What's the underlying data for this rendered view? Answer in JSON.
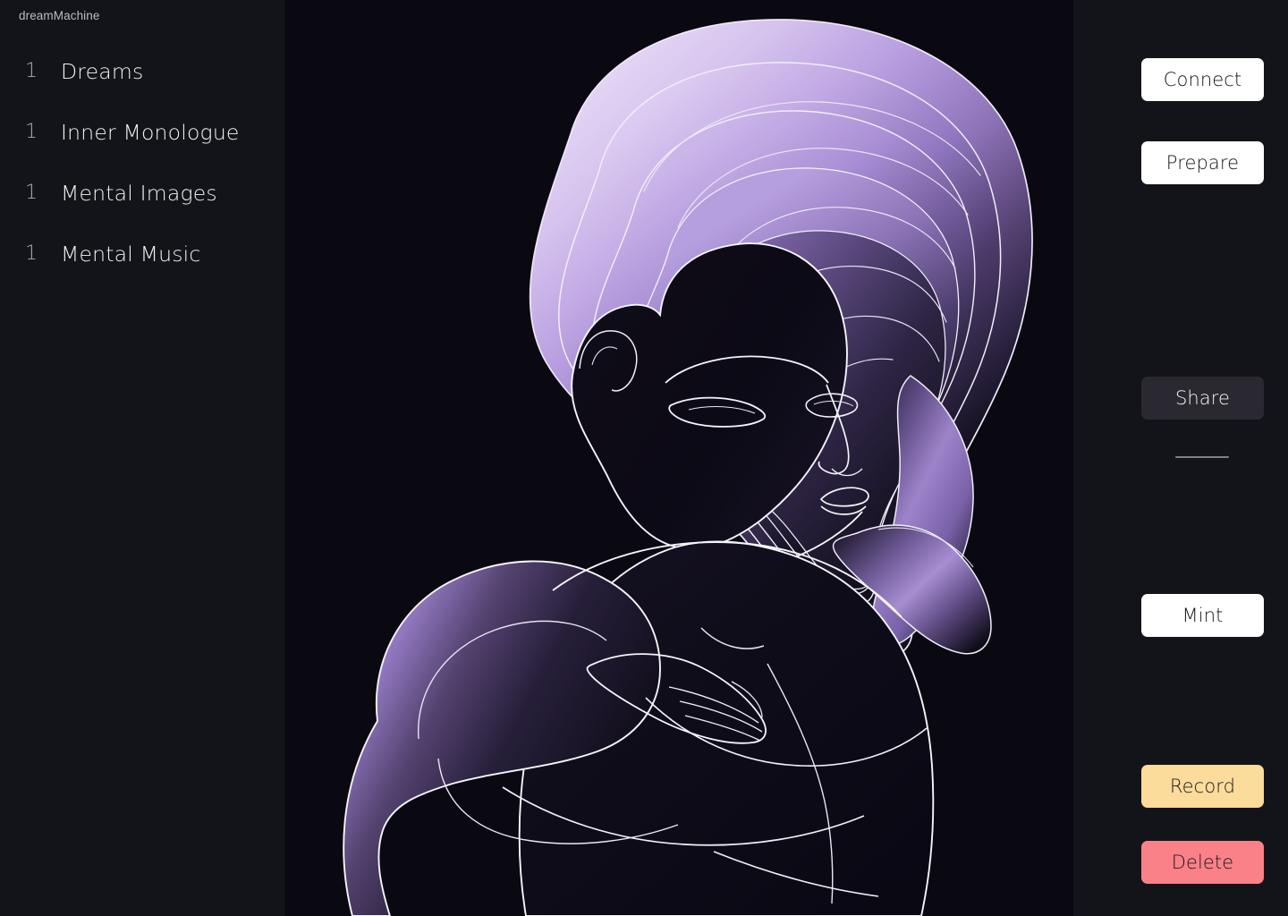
{
  "app": {
    "title": "dreamMachine",
    "background_color": "#131419",
    "canvas_color": "#0a0912"
  },
  "sidebar": {
    "items": [
      {
        "index": "1",
        "label": "Dreams"
      },
      {
        "index": "1",
        "label": "Inner Monologue"
      },
      {
        "index": "1",
        "label": "Mental Images"
      },
      {
        "index": "1",
        "label": "Mental Music"
      }
    ]
  },
  "artwork": {
    "alt": "line-art illustration of a woman with long flowing purple hair, head tilted down, hand on chest",
    "line_color": "#ffffff",
    "hair_light": "#e0d0f2",
    "hair_mid": "#a98fd0",
    "hair_dark": "#2a2038",
    "body_dark": "#0d0b16"
  },
  "actions": {
    "connect": {
      "label": "Connect",
      "style": "light",
      "bg": "#ffffff",
      "fg": "#15161b"
    },
    "prepare": {
      "label": "Prepare",
      "style": "light",
      "bg": "#ffffff",
      "fg": "#15161b"
    },
    "share": {
      "label": "Share",
      "style": "muted",
      "bg": "#2a2830",
      "fg": "#f4f4f6"
    },
    "mint": {
      "label": "Mint",
      "style": "light",
      "bg": "#ffffff",
      "fg": "#15161b"
    },
    "record": {
      "label": "Record",
      "style": "warn",
      "bg": "#fbdc9b",
      "fg": "#1b1b1f"
    },
    "delete": {
      "label": "Delete",
      "style": "danger",
      "bg": "#fb8189",
      "fg": "#1b1b1f"
    }
  }
}
